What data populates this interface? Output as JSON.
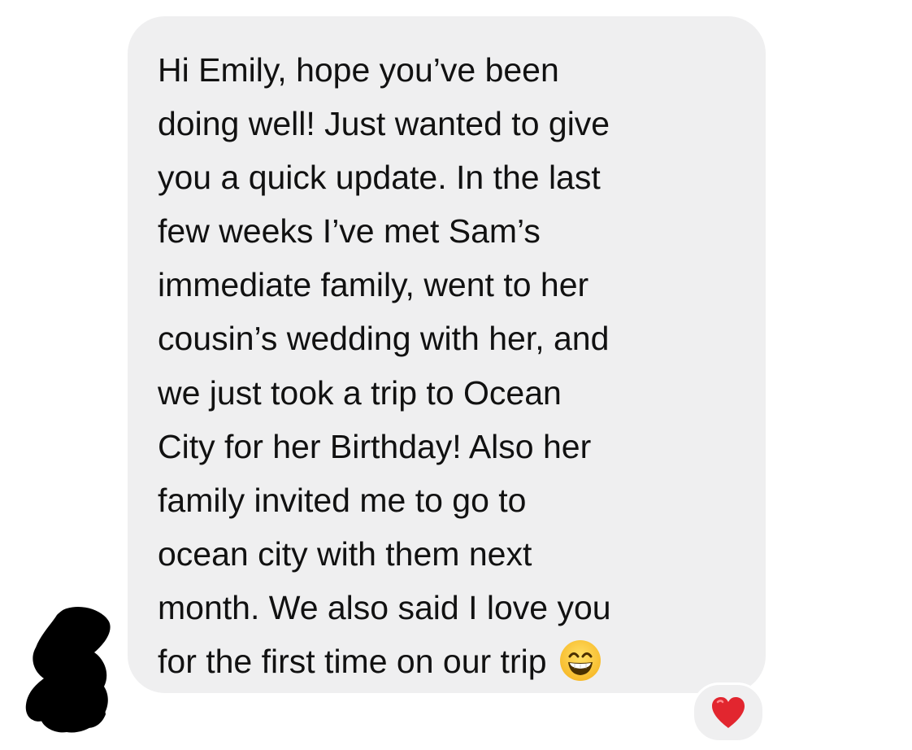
{
  "message": {
    "lines": [
      "Hi Emily, hope you’ve been",
      "doing well! Just wanted to give",
      "you a quick update. In the last",
      "few weeks I’ve met Sam’s",
      "immediate family, went to her",
      "cousin’s wedding with her, and",
      "we just took a trip to Ocean",
      "City for her Birthday! Also her",
      "family invited me to go to",
      "ocean city with them next",
      "month.  We also said I love you",
      "for the first time on our trip"
    ],
    "trailing_emoji": "grinning-face-with-smiling-eyes-icon"
  },
  "reaction": {
    "icon": "red-heart-icon",
    "color": "#e2262f"
  },
  "colors": {
    "bubble": "#efeff0",
    "text": "#111111",
    "background": "#ffffff"
  }
}
